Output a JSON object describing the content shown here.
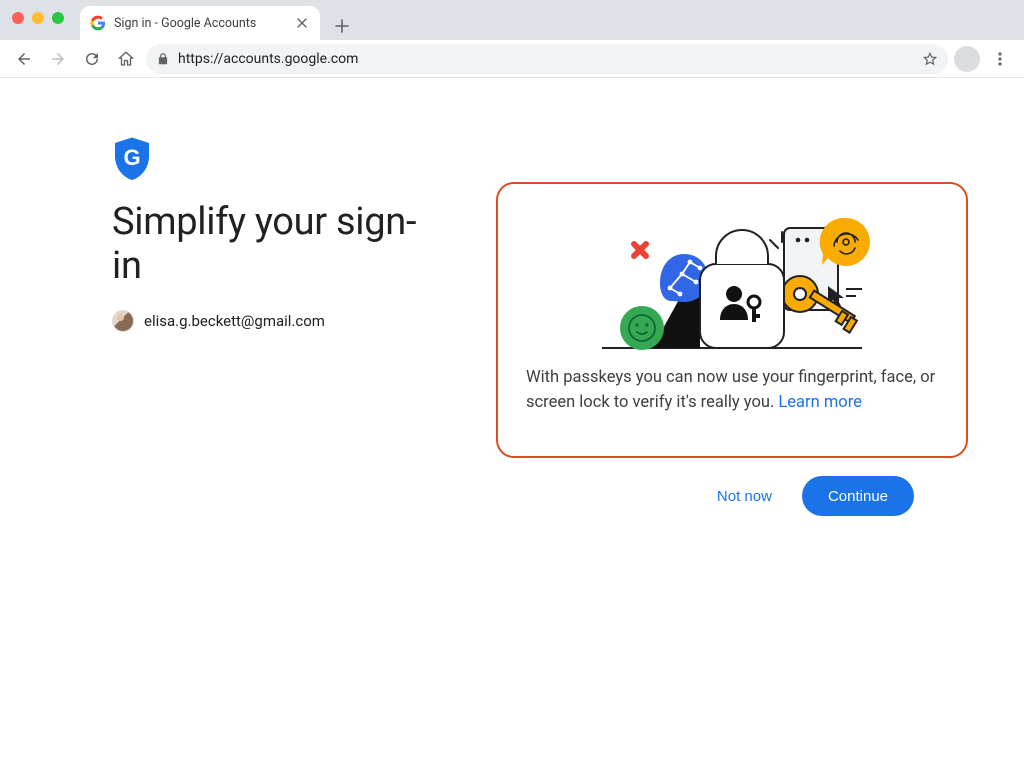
{
  "browser": {
    "tab_title": "Sign in - Google Accounts",
    "url": "https://accounts.google.com"
  },
  "page": {
    "heading": "Simplify your sign-in",
    "account_email": "elisa.g.beckett@gmail.com",
    "card": {
      "body_text": "With passkeys you can now use your fingerprint, face, or screen lock to verify it's really you. ",
      "learn_more_label": "Learn more"
    },
    "actions": {
      "not_now_label": "Not now",
      "continue_label": "Continue"
    }
  },
  "colors": {
    "highlight_border": "#d94c24",
    "primary_blue": "#1a73e8",
    "amber": "#f9ab00",
    "green": "#34a853"
  }
}
